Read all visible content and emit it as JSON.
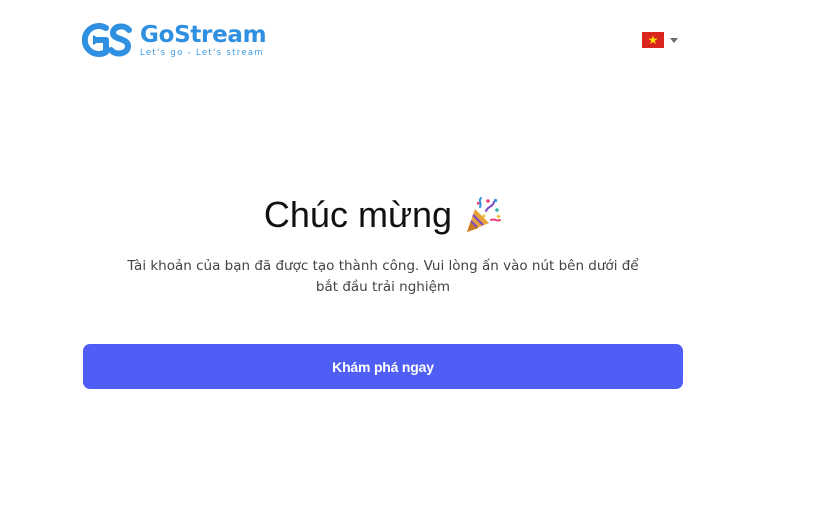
{
  "header": {
    "brand_name": "GoStream",
    "brand_tagline": "Let's go - Let's stream",
    "logo_icon": "gostream-logo-icon",
    "brand_color": "#2f8fe0",
    "language": {
      "flag_icon": "vietnam-flag-icon",
      "dropdown_icon": "caret-down-icon"
    }
  },
  "main": {
    "title": "Chúc mừng",
    "title_icon": "party-popper-icon",
    "message": "Tài khoản của bạn đã được tạo thành công. Vui lòng ấn vào nút bên dưới để bắt đầu trải nghiệm",
    "cta_label": "Khám phá ngay",
    "cta_color": "#4f5ef5"
  }
}
